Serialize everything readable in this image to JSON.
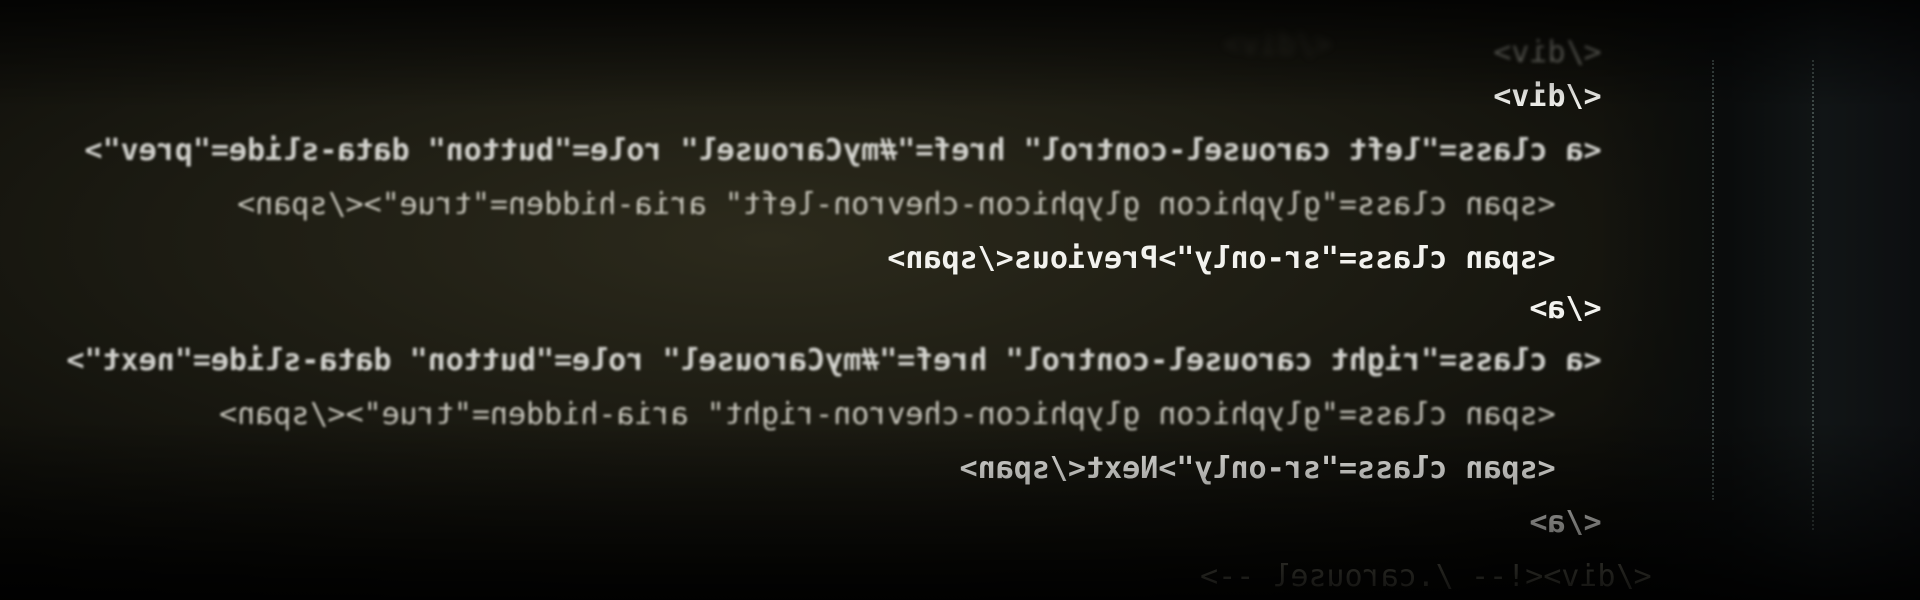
{
  "code_lines": [
    {
      "text": "</div>"
    },
    {
      "text": "</div>"
    },
    {
      "text": "<a class=\"left carousel-control\" href=\"#myCarousel\" role=\"button\" data-slide=\"prev\">"
    },
    {
      "text": "<span class=\"glyphicon glyphicon-chevron-left\" aria-hidden=\"true\"></span>"
    },
    {
      "text": "<span class=\"sr-only\">Previous</span>"
    },
    {
      "text": "</a>"
    },
    {
      "text": "<a class=\"right carousel-control\" href=\"#myCarousel\" role=\"button\" data-slide=\"next\">"
    },
    {
      "text": "<span class=\"glyphicon glyphicon-chevron-right\" aria-hidden=\"true\"></span>"
    },
    {
      "text": "<span class=\"sr-only\">Next</span>"
    },
    {
      "text": "</a>"
    },
    {
      "text": "</div><!-- /.carousel -->"
    }
  ]
}
